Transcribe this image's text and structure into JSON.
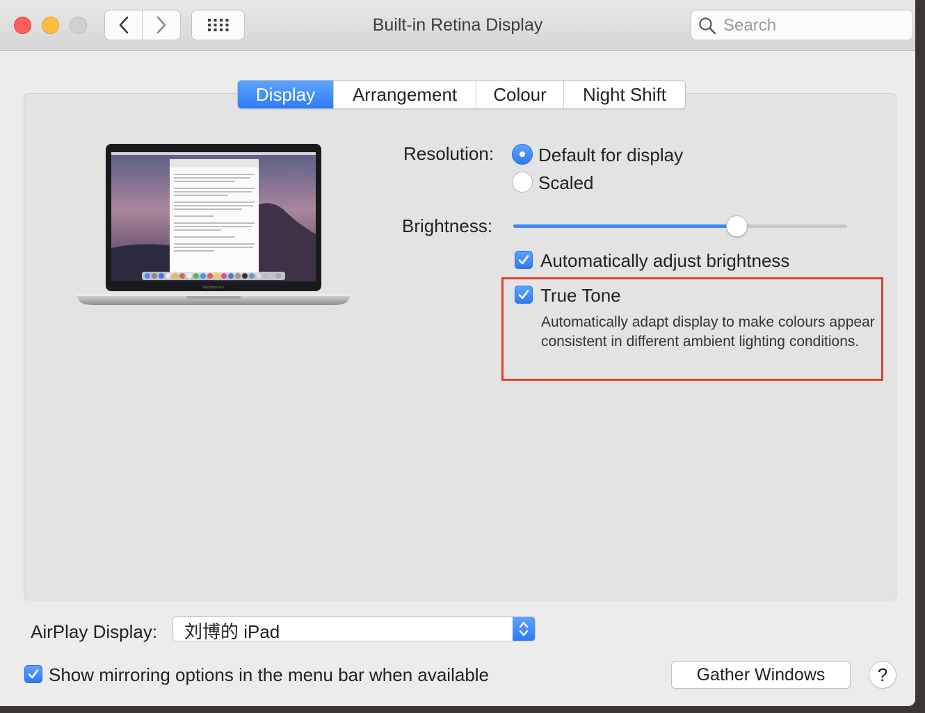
{
  "window": {
    "title": "Built-in Retina Display",
    "search_placeholder": "Search"
  },
  "tabs": [
    {
      "label": "Display",
      "active": true
    },
    {
      "label": "Arrangement",
      "active": false
    },
    {
      "label": "Colour",
      "active": false
    },
    {
      "label": "Night Shift",
      "active": false
    }
  ],
  "display": {
    "resolution_label": "Resolution:",
    "resolution_options": [
      {
        "label": "Default for display",
        "selected": true
      },
      {
        "label": "Scaled",
        "selected": false
      }
    ],
    "brightness_label": "Brightness:",
    "brightness_value": 0.67,
    "auto_brightness": {
      "label": "Automatically adjust brightness",
      "checked": true
    },
    "true_tone": {
      "label": "True Tone",
      "checked": true,
      "description": "Automatically adapt display to make colours appear consistent in different ambient lighting conditions."
    }
  },
  "airplay": {
    "label": "AirPlay Display:",
    "selected": "刘博的 iPad"
  },
  "mirroring": {
    "label": "Show mirroring options in the menu bar when available",
    "checked": true
  },
  "buttons": {
    "gather_windows": "Gather Windows",
    "help": "?"
  },
  "colors": {
    "accent": "#2d7cf6",
    "highlight_box": "#e0412e"
  },
  "laptop_label": "MacBook Pro"
}
